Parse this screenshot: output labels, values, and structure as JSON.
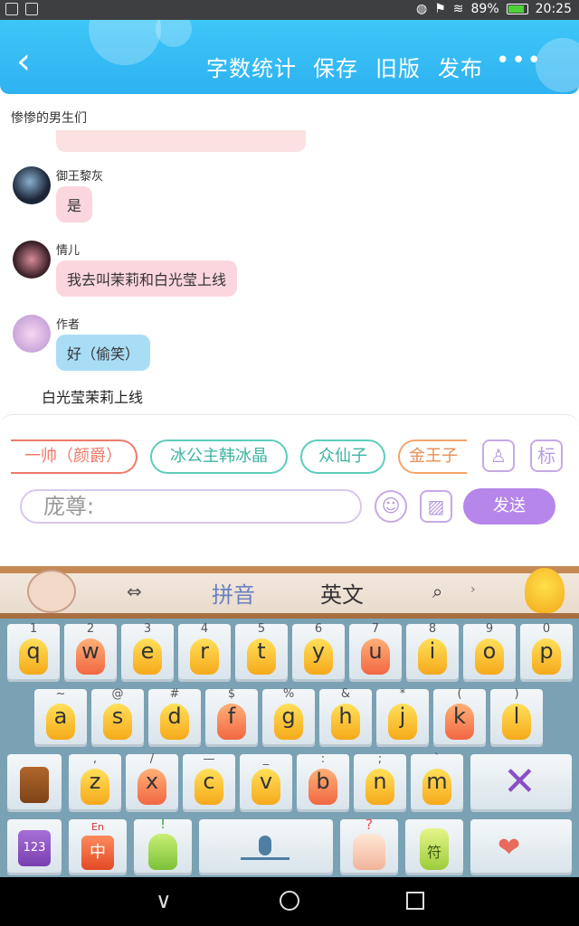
{
  "status_bar": {
    "battery": "89%",
    "time": "20:25"
  },
  "header": {
    "back_icon": "chevron-left-icon",
    "word_count": "字数统计",
    "save": "保存",
    "old_version": "旧版",
    "publish": "发布",
    "more_icon": "more-icon"
  },
  "chat": {
    "group_title": "惨惨的男生们",
    "messages": [
      {
        "name": "御王黎灰",
        "text": "是"
      },
      {
        "name": "情儿",
        "text": "我去叫茉莉和白光莹上线"
      },
      {
        "name": "作者",
        "text": "好（偷笑）"
      }
    ],
    "narration": "白光莹茉莉上线"
  },
  "panel": {
    "roles": [
      "一帅（颜爵）",
      "冰公主韩冰晶",
      "众仙子",
      "金王子"
    ],
    "role_colors": [
      "#f07a6a",
      "#5ccdbb",
      "#5ccdbb",
      "#f2a46c"
    ],
    "mark_label": "标",
    "input_text": "庞尊:",
    "send": "发送",
    "accent": "#b686ea"
  },
  "keyboard": {
    "pinyin": "拼音",
    "english": "英文",
    "row1": [
      {
        "num": "1",
        "ch": "q"
      },
      {
        "num": "2",
        "ch": "w"
      },
      {
        "num": "3",
        "ch": "e"
      },
      {
        "num": "4",
        "ch": "r"
      },
      {
        "num": "5",
        "ch": "t"
      },
      {
        "num": "6",
        "ch": "y"
      },
      {
        "num": "7",
        "ch": "u"
      },
      {
        "num": "8",
        "ch": "i"
      },
      {
        "num": "9",
        "ch": "o"
      },
      {
        "num": "0",
        "ch": "p"
      }
    ],
    "row2": [
      {
        "num": "~",
        "ch": "a"
      },
      {
        "num": "@",
        "ch": "s"
      },
      {
        "num": "#",
        "ch": "d"
      },
      {
        "num": "$",
        "ch": "f"
      },
      {
        "num": "%",
        "ch": "g"
      },
      {
        "num": "&",
        "ch": "h"
      },
      {
        "num": "*",
        "ch": "j"
      },
      {
        "num": "(",
        "ch": "k"
      },
      {
        "num": ")",
        "ch": "l"
      }
    ],
    "row3": [
      {
        "num": ",",
        "ch": "z"
      },
      {
        "num": "/",
        "ch": "x"
      },
      {
        "num": "—",
        "ch": "c"
      },
      {
        "num": "_",
        "ch": "v"
      },
      {
        "num": ":",
        "ch": "b"
      },
      {
        "num": ";",
        "ch": "n"
      },
      {
        "num": "`",
        "ch": "m"
      }
    ],
    "num_key": "123",
    "en_label": "En",
    "zh_label": "中",
    "excl": "!",
    "question": "?",
    "symbol": "符"
  }
}
